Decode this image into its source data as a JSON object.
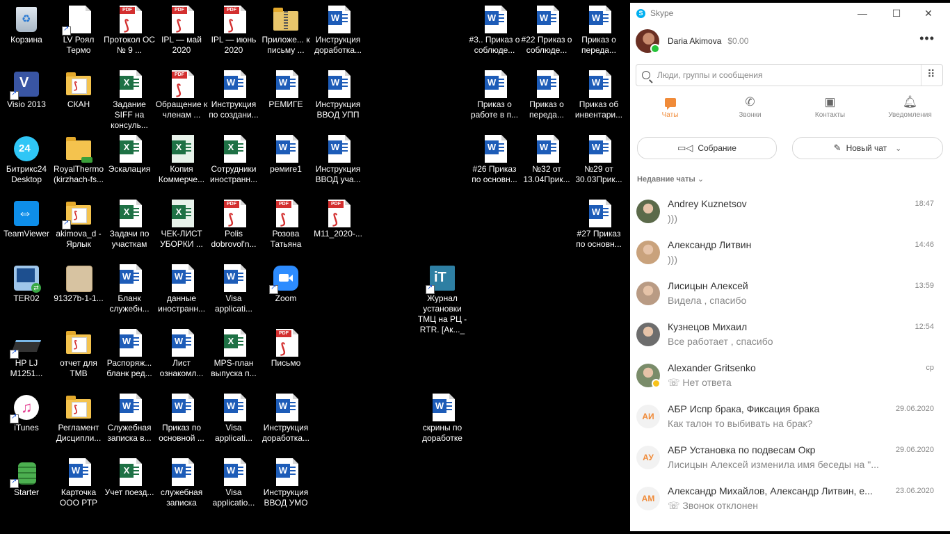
{
  "desktop": {
    "icons": [
      {
        "label": "Корзина",
        "type": "recycle"
      },
      {
        "label": "LV Роял Термо",
        "type": "blank",
        "sc": true
      },
      {
        "label": "Протокол ОС № 9 ...",
        "type": "pdf"
      },
      {
        "label": "IPL — май 2020",
        "type": "pdf"
      },
      {
        "label": "IPL — июнь 2020",
        "type": "pdf"
      },
      {
        "label": "Приложе... к письму ...",
        "type": "zip"
      },
      {
        "label": "Инструкция доработка...",
        "type": "word"
      },
      {
        "label": "#3.. Приказ о соблюде...",
        "type": "word"
      },
      {
        "label": "#22 Приказ о соблюде...",
        "type": "word"
      },
      {
        "label": "Приказ о переда...",
        "type": "word"
      },
      {
        "label": "Visio 2013",
        "type": "visio",
        "sc": true
      },
      {
        "label": "СКАН",
        "type": "folderpdf"
      },
      {
        "label": "Задание SIFF на консуль...",
        "type": "excel"
      },
      {
        "label": "Обращение к членам ...",
        "type": "pdf"
      },
      {
        "label": "Инструкция по создани...",
        "type": "word"
      },
      {
        "label": "РЕМИГЕ",
        "type": "word"
      },
      {
        "label": "Инструкция ВВОД УПП",
        "type": "word"
      },
      {
        "label": "Приказ о работе в п...",
        "type": "word"
      },
      {
        "label": "Приказ о переда...",
        "type": "word"
      },
      {
        "label": "Приказ об инвентари...",
        "type": "word"
      },
      {
        "label": "Битрикс24 Desktop",
        "type": "bitrix"
      },
      {
        "label": "RoyalThermo (kirzhach-fs...",
        "type": "netfolder"
      },
      {
        "label": "Эскалация",
        "type": "excel"
      },
      {
        "label": "Копия Коммерче...",
        "type": "excelgreen"
      },
      {
        "label": "Сотрудники иностранн...",
        "type": "excel"
      },
      {
        "label": "ремиге1",
        "type": "word"
      },
      {
        "label": "Инструкция ВВОД уча...",
        "type": "word"
      },
      {
        "label": "#26 Приказ по основн...",
        "type": "word"
      },
      {
        "label": "№32  от 13.04Прик...",
        "type": "word"
      },
      {
        "label": "№29 от 30.03Прик...",
        "type": "word"
      },
      {
        "label": "TeamViewer",
        "type": "teamviewer"
      },
      {
        "label": "akimova_d - Ярлык",
        "type": "folderpdf",
        "sc": true
      },
      {
        "label": "Задачи по участкам",
        "type": "excel"
      },
      {
        "label": "ЧЕК-ЛИСТ УБОРКИ ...",
        "type": "excelgreen"
      },
      {
        "label": "Polis dobrovol'n...",
        "type": "pdf"
      },
      {
        "label": "Розова Татьяна",
        "type": "pdf"
      },
      {
        "label": "M11_2020-...",
        "type": "pdf"
      },
      {
        "label": "#27 Приказ по основн...",
        "type": "word"
      },
      {
        "label": "TER02",
        "type": "rdp"
      },
      {
        "label": "91327b-1-1...",
        "type": "image"
      },
      {
        "label": "Бланк служебн...",
        "type": "word"
      },
      {
        "label": "данные иностранн...",
        "type": "word"
      },
      {
        "label": "Visa applicati...",
        "type": "word"
      },
      {
        "label": "Zoom",
        "type": "zoom",
        "sc": true
      },
      {
        "label": "Журнал установки ТМЦ на РЦ - RTR. [Ак..._",
        "type": "it",
        "sc": true
      },
      {
        "label": "HP LJ M1251...",
        "type": "scanner",
        "sc": true
      },
      {
        "label": "отчет для ТМВ",
        "type": "folderpdf"
      },
      {
        "label": "Распоряж... бланк ред...",
        "type": "word"
      },
      {
        "label": "Лист ознакомл...",
        "type": "word"
      },
      {
        "label": "MPS-план выпуска п...",
        "type": "excel"
      },
      {
        "label": "Письмо",
        "type": "pdf"
      },
      {
        "label": "iTunes",
        "type": "itunes",
        "sc": true
      },
      {
        "label": "Регламент Дисципли...",
        "type": "folderpdf"
      },
      {
        "label": "Служебная записка в...",
        "type": "word"
      },
      {
        "label": "Приказ по основной ...",
        "type": "word"
      },
      {
        "label": "Visa applicati...",
        "type": "word"
      },
      {
        "label": "Инструкция доработка...",
        "type": "word"
      },
      {
        "label": "скрины по доработке",
        "type": "word"
      },
      {
        "label": "Starter",
        "type": "starter",
        "sc": true
      },
      {
        "label": "Карточка ООО РТР",
        "type": "word"
      },
      {
        "label": "Учет поезд...",
        "type": "excel"
      },
      {
        "label": "служебная записка",
        "type": "word"
      },
      {
        "label": "Visa applicatio...",
        "type": "word"
      },
      {
        "label": "Инструкция ВВОД УМО",
        "type": "word"
      }
    ]
  },
  "skype": {
    "title": "Skype",
    "logo_letter": "S",
    "window_buttons": {
      "minimize": "—",
      "maximize": "☐",
      "close": "✕"
    },
    "profile": {
      "name": "Daria Akimova",
      "credit": "$0.00",
      "more": "•••"
    },
    "search_placeholder": "Люди, группы и сообщения",
    "tabs": [
      {
        "label": "Чаты",
        "active": true,
        "icon": "chat-icon"
      },
      {
        "label": "Звонки",
        "active": false,
        "icon": "phone-icon"
      },
      {
        "label": "Контакты",
        "active": false,
        "icon": "contacts-icon"
      },
      {
        "label": "Уведомления",
        "active": false,
        "icon": "bell-icon"
      }
    ],
    "meeting_label": "Собрание",
    "new_chat_label": "Новый чат",
    "recent_label": "Недавние чаты",
    "accent": "#f08b39",
    "chats": [
      {
        "name": "Andrey Kuznetsov",
        "message": ")))",
        "time": "18:47",
        "avatar": "photo",
        "color": "#5b6a4a"
      },
      {
        "name": "Александр Литвин",
        "message": ")))",
        "time": "14:46",
        "avatar": "photo",
        "color": "#c9a27c"
      },
      {
        "name": "Лисицын Алексей",
        "message": "Видела , спасибо",
        "time": "13:59",
        "avatar": "photo",
        "color": "#b99b84"
      },
      {
        "name": "Кузнецов Михаил",
        "message": "Все работает , спасибо",
        "time": "12:54",
        "avatar": "photo",
        "color": "#6d6d6d"
      },
      {
        "name": "Alexander Gritsenko",
        "message": "Нет ответа",
        "time": "ср",
        "avatar": "photo",
        "color": "#7a8c6a",
        "away": true,
        "call": true
      },
      {
        "name": "АБР Испр брака, Фиксация брака",
        "message": "Как талон то выбивать на брак?",
        "time": "29.06.2020",
        "avatar": "initials",
        "initials": "АИ"
      },
      {
        "name": "АБР Установка по подвесам Окр",
        "message": "Лисицын Алексей изменила имя беседы на \"...",
        "time": "29.06.2020",
        "avatar": "initials",
        "initials": "АУ"
      },
      {
        "name": "Александр Михайлов, Александр Литвин, е...",
        "message": "Звонок отклонен",
        "time": "23.06.2020",
        "avatar": "initials",
        "initials": "АМ",
        "call": true
      }
    ]
  }
}
